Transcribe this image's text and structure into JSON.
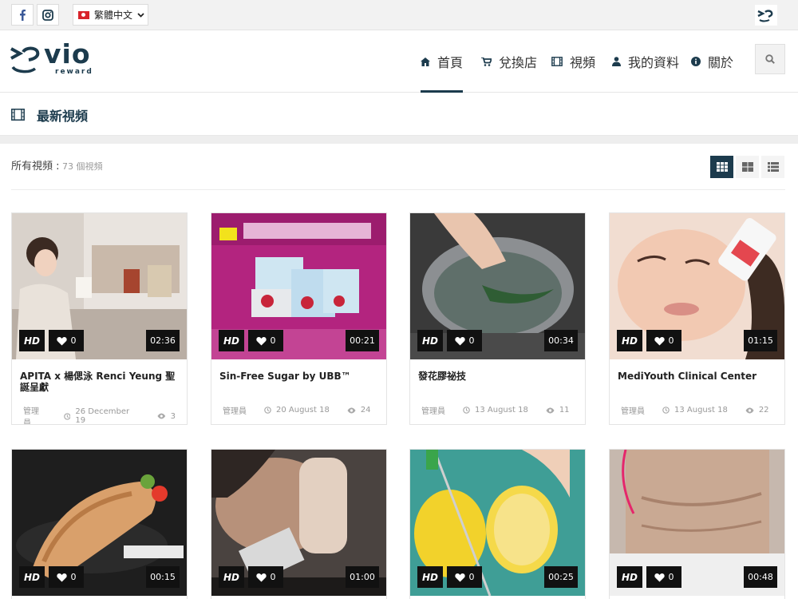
{
  "topbar": {
    "language": "繁體中文"
  },
  "logo": {
    "text": "vio",
    "subtext": "reward"
  },
  "nav": [
    {
      "label": "首頁",
      "icon": "home-icon"
    },
    {
      "label": "兌換店",
      "icon": "cart-icon"
    },
    {
      "label": "視頻",
      "icon": "film-icon"
    },
    {
      "label": "我的資料",
      "icon": "user-icon"
    },
    {
      "label": "關於",
      "icon": "info-icon"
    }
  ],
  "section": {
    "title": "最新視頻"
  },
  "listing": {
    "label": "所有視頻 :",
    "count": " 73 個視頻"
  },
  "colors": {
    "brand": "#1c3b4d",
    "badge": "#111111"
  },
  "videos": [
    {
      "title": "APITA x 楊偲泳 Renci Yeung 聖誕呈獻",
      "hd": "HD",
      "likes": "0",
      "duration": "02:36",
      "author": "管理員",
      "date": "26 December 19",
      "views": "3"
    },
    {
      "title": "Sin-Free Sugar by UBB™",
      "hd": "HD",
      "likes": "0",
      "duration": "00:21",
      "author": "管理員",
      "date": "20 August 18",
      "views": "24"
    },
    {
      "title": "發花膠祕技",
      "hd": "HD",
      "likes": "0",
      "duration": "00:34",
      "author": "管理員",
      "date": "13 August 18",
      "views": "11"
    },
    {
      "title": "MediYouth Clinical Center",
      "hd": "HD",
      "likes": "0",
      "duration": "01:15",
      "author": "管理員",
      "date": "13 August 18",
      "views": "22"
    },
    {
      "title": "",
      "hd": "HD",
      "likes": "0",
      "duration": "00:15"
    },
    {
      "title": "",
      "hd": "HD",
      "likes": "0",
      "duration": "01:00"
    },
    {
      "title": "",
      "hd": "HD",
      "likes": "0",
      "duration": "00:25"
    },
    {
      "title": "",
      "hd": "HD",
      "likes": "0",
      "duration": "00:48"
    }
  ]
}
